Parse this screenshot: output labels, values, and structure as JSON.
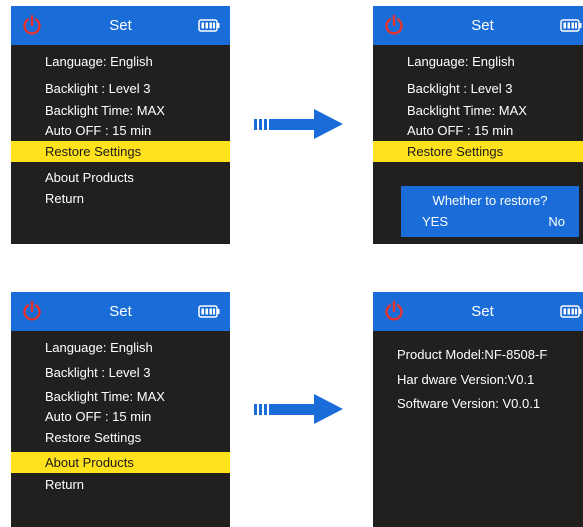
{
  "brand": {
    "topbar": "#1a6dd8",
    "highlight": "#ffe21b",
    "screen_bg": "#221f1f",
    "power_icon": "#e8332d",
    "arrow": "#1a6dd8"
  },
  "icons": {
    "power": "power-icon",
    "battery": "battery-icon",
    "arrow": "right-arrow-icon"
  },
  "header": {
    "title": "Set"
  },
  "menu": {
    "language": "Language: English",
    "backlight": "Backlight : Level 3",
    "backlight_time": "Backlight Time: MAX",
    "auto_off": "Auto OFF : 15 min",
    "restore": "Restore Settings",
    "about": "About Products",
    "return": "Return"
  },
  "dialog": {
    "question": "Whether to restore?",
    "yes": "YES",
    "no": "No"
  },
  "about": {
    "model": "Product Model:NF-8508-F",
    "hardware": "Har dware Version:V0.1",
    "software": "Software Version: V0.0.1"
  }
}
